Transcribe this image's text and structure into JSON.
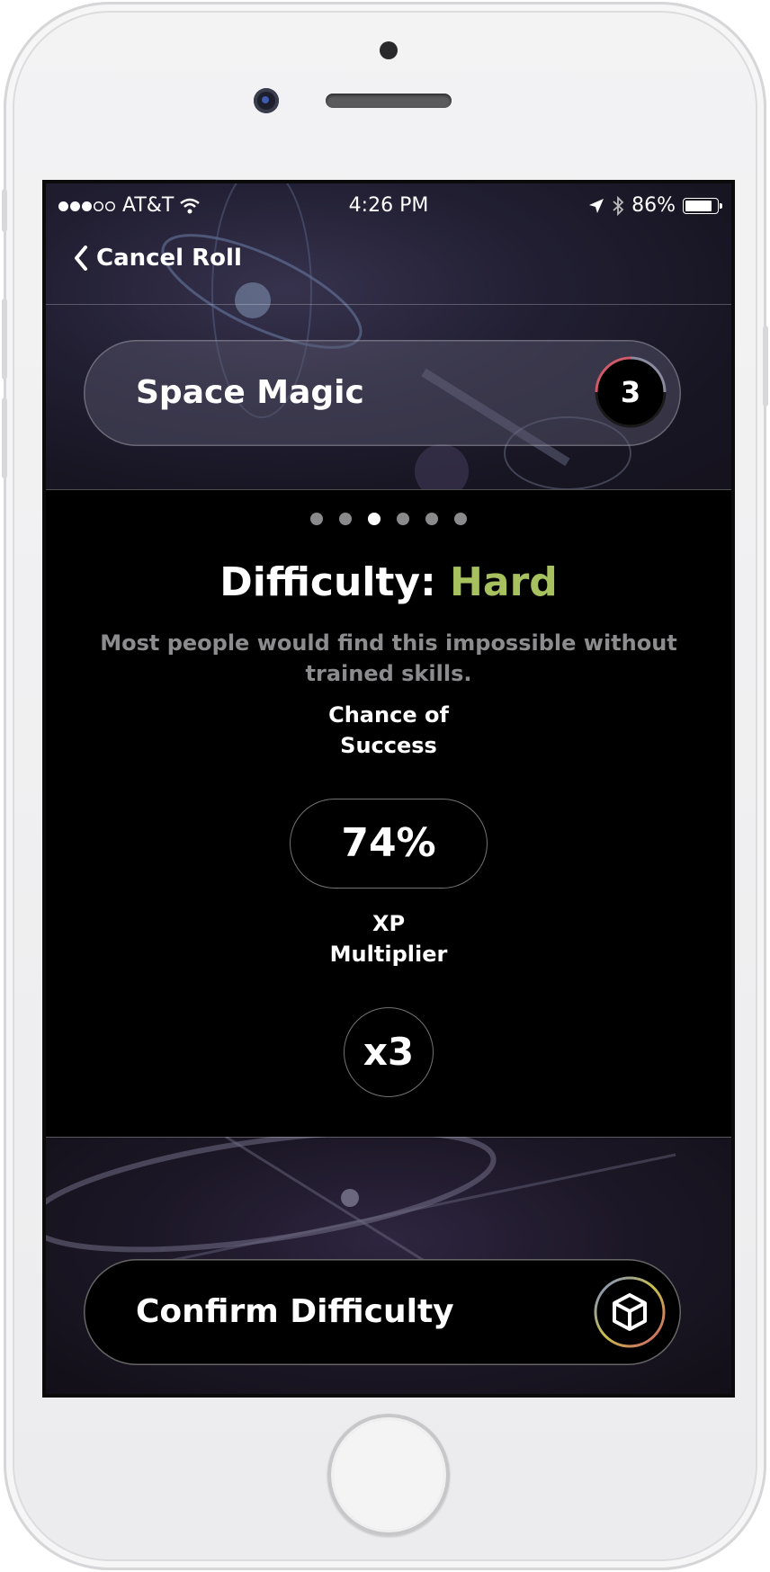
{
  "status_bar": {
    "signal_dots": [
      true,
      true,
      true,
      false,
      false
    ],
    "carrier": "AT&T",
    "time": "4:26 PM",
    "battery": "86%",
    "battery_level": 0.86
  },
  "nav": {
    "back_label": "Cancel Roll"
  },
  "skill": {
    "name": "Space Magic",
    "level": "3"
  },
  "pager": {
    "count": 6,
    "active_index": 2
  },
  "difficulty": {
    "prefix": "Difficulty:",
    "level": "Hard",
    "level_color": "#a6c15e",
    "description": "Most people would find this impossible without trained skills."
  },
  "chance": {
    "label_line1": "Chance of",
    "label_line2": "Success",
    "value": "74%"
  },
  "xp": {
    "label_line1": "XP",
    "label_line2": "Multiplier",
    "value": "x3"
  },
  "confirm": {
    "label": "Confirm Difficulty",
    "icon": "dice-cube-icon"
  }
}
